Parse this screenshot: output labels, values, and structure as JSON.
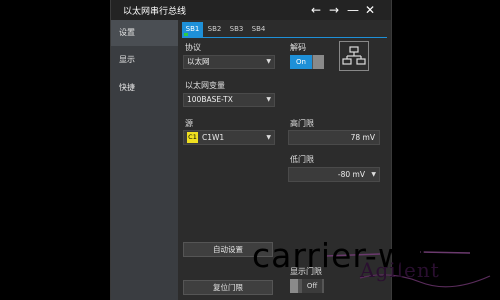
{
  "window": {
    "title": "以太网串行总线",
    "left_arrow_icon": "arrow-left-icon",
    "right_arrow_icon": "arrow-right-icon",
    "minimize_icon": "minimize-icon",
    "close_icon": "close-icon"
  },
  "sidebar": {
    "items": [
      {
        "label": "设置"
      },
      {
        "label": "显示"
      },
      {
        "label": "快捷"
      }
    ]
  },
  "tabs": [
    {
      "label": "SB1"
    },
    {
      "label": "SB2"
    },
    {
      "label": "SB3"
    },
    {
      "label": "SB4"
    }
  ],
  "protocol": {
    "label": "协议",
    "value": "以太网"
  },
  "decode": {
    "label": "解码",
    "value": "On"
  },
  "variant": {
    "label": "以太网变量",
    "value": "100BASE-TX"
  },
  "source": {
    "label": "源",
    "badge": "C1",
    "value": "C1W1"
  },
  "high_threshold": {
    "label": "高门限",
    "value": "78 mV"
  },
  "low_threshold": {
    "label": "低门限",
    "value": "-80 mV"
  },
  "buttons": {
    "auto_setup": "自动设置",
    "reset_threshold": "复位门限"
  },
  "show_threshold": {
    "label": "显示门限",
    "value": "Off"
  },
  "watermark": {
    "text": "carrier-wu",
    "brand": "Agilent"
  },
  "colors": {
    "accent": "#1e90d8",
    "badge": "#f0e020",
    "tab_dot": "#2ecc40"
  }
}
